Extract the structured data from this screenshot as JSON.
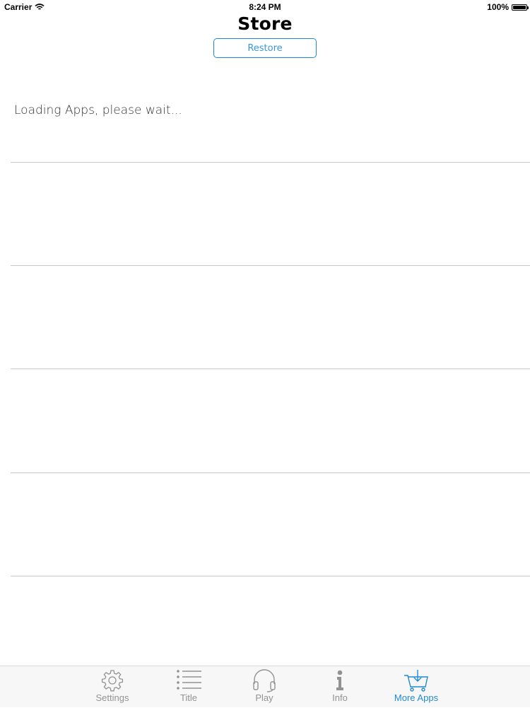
{
  "status_bar": {
    "carrier": "Carrier",
    "time": "8:24 PM",
    "battery": "100%",
    "battery_level": 1.0
  },
  "nav": {
    "title": "Store",
    "restore_label": "Restore"
  },
  "content": {
    "loading_message": "Loading Apps, please wait..."
  },
  "tabs": [
    {
      "label": "Settings",
      "icon": "gear-icon",
      "active": false
    },
    {
      "label": "Title",
      "icon": "list-icon",
      "active": false
    },
    {
      "label": "Play",
      "icon": "headphones-icon",
      "active": false
    },
    {
      "label": "Info",
      "icon": "info-icon",
      "active": false
    },
    {
      "label": "More Apps",
      "icon": "cart-icon",
      "active": true
    }
  ],
  "colors": {
    "accent": "#1e8bd1",
    "inactive_tab": "#929292",
    "divider": "#c8c7cc",
    "tab_bar_bg": "#f7f7f7"
  }
}
